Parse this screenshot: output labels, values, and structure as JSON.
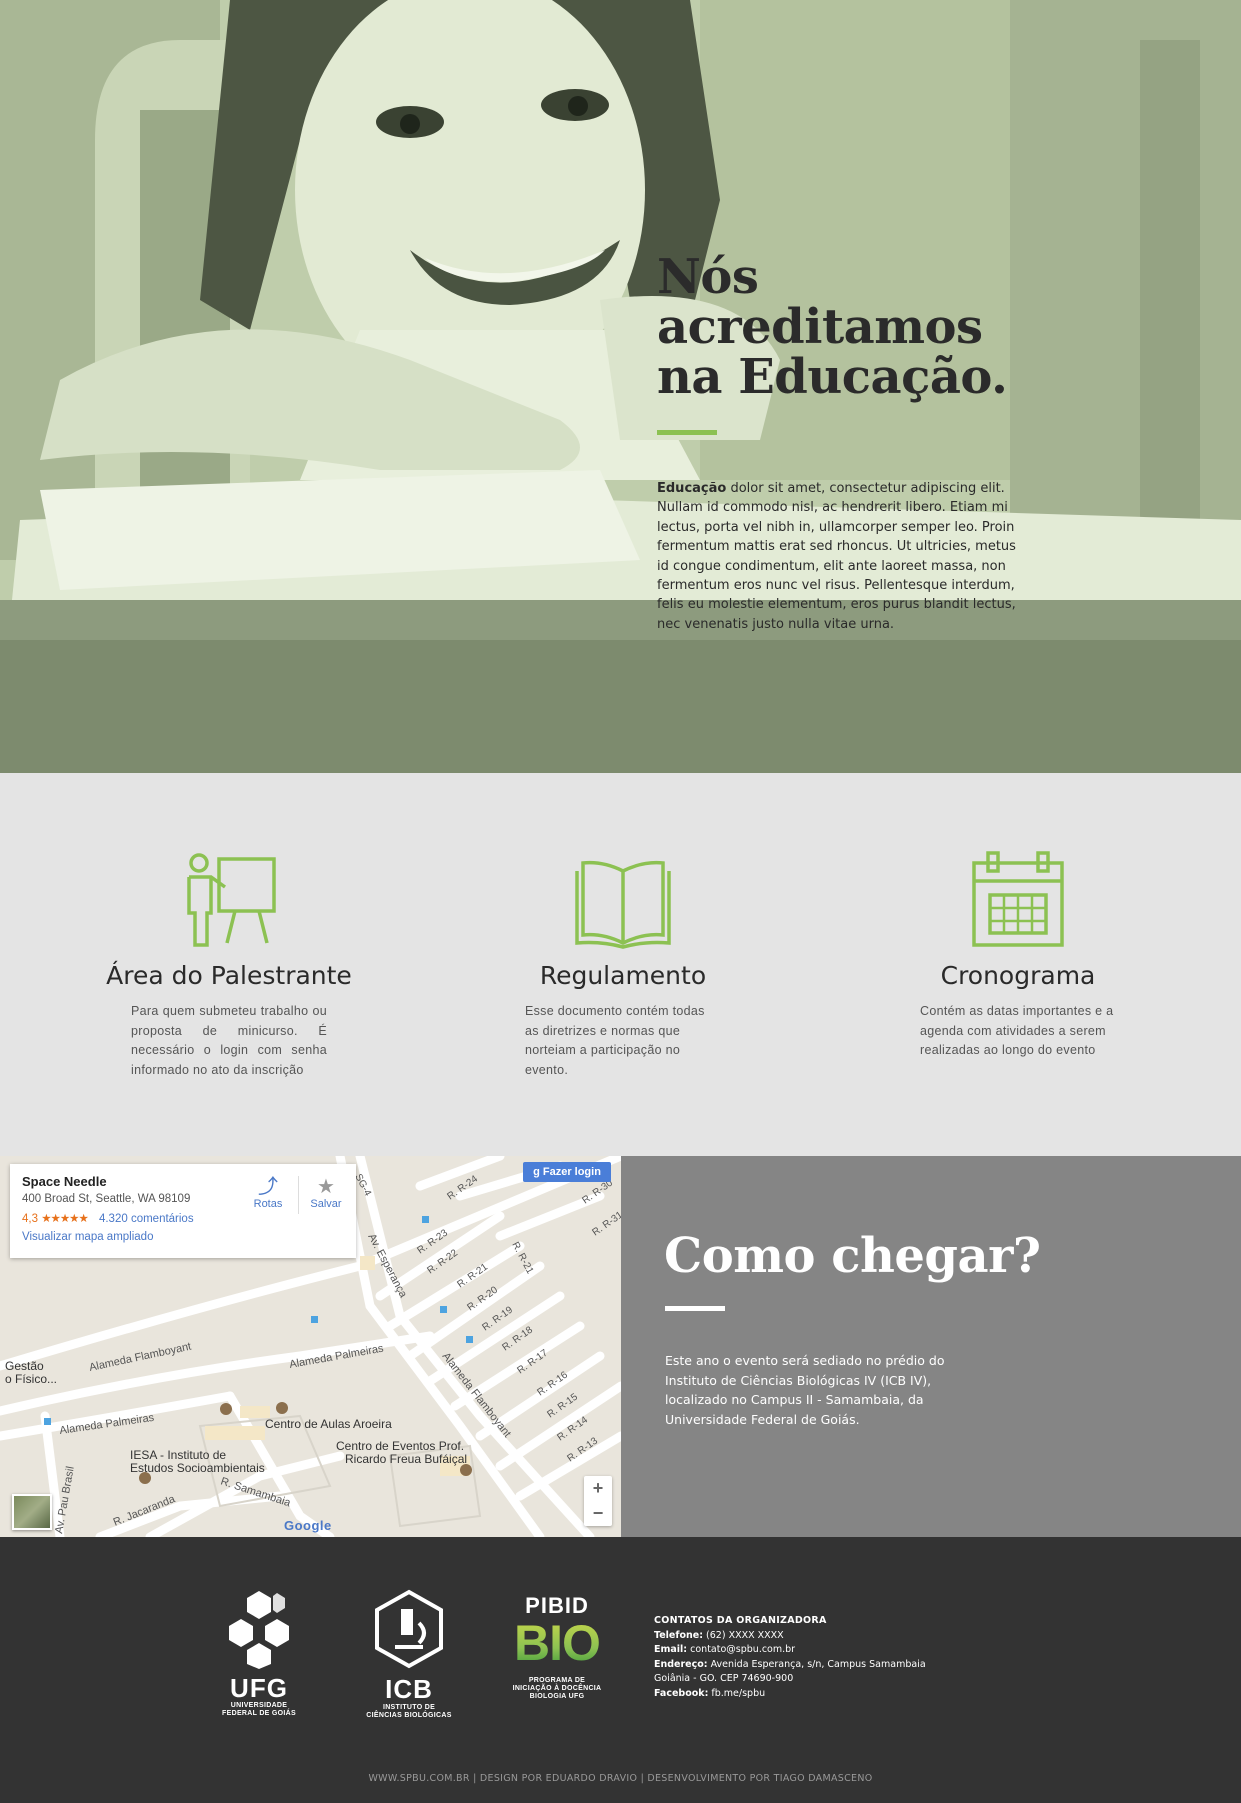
{
  "hero": {
    "title_line1": "Nós acreditamos",
    "title_line2": "na Educação.",
    "body_lead": "Educação",
    "body_text": " dolor sit amet, consectetur adipiscing elit. Nullam id commodo nisl, ac hendrerit libero. Etiam mi lectus, porta vel nibh in, ullamcorper semper leo. Proin fermentum mattis erat sed rhoncus. Ut ultricies, metus id congue condimentum, elit ante laoreet massa, non fermentum eros nunc vel risus. Pellentesque interdum, felis eu molestie elementum, eros purus blandit lectus, nec venenatis justo nulla vitae urna."
  },
  "features": [
    {
      "icon": "presenter-board-icon",
      "title": "Área do Palestrante",
      "text": "Para quem submeteu trabalho ou proposta de minicurso. É necessário o login com senha informado no ato da inscrição"
    },
    {
      "icon": "open-book-icon",
      "title": "Regulamento",
      "text": "Esse documento contém todas as diretrizes e normas que norteiam a participação no evento."
    },
    {
      "icon": "calendar-icon",
      "title": "Cronograma",
      "text": "Contém as datas importantes e a agenda com atividades a serem realizadas ao longo do evento"
    }
  ],
  "map": {
    "place_name": "Space Needle",
    "address": "400 Broad St, Seattle, WA 98109",
    "rating": "4,3",
    "stars": "★★★★★",
    "reviews": "4.320 comentários",
    "view_larger": "Visualizar mapa ampliado",
    "directions_label": "Rotas",
    "save_label": "Salvar",
    "login_label": "Fazer login",
    "zoom_in": "+",
    "zoom_out": "−",
    "google": "Google",
    "streets": [
      "Alameda Flamboyant",
      "Alameda Palmeiras",
      "Alameda Palmeiras",
      "Av. Esperança",
      "Alameda Flamboyant",
      "R. Samambaia",
      "R. Jacaranda",
      "Av. Pau Brasil",
      "R. R-24",
      "R. R-23",
      "R. R-22",
      "R. R-21",
      "R. R-20",
      "R. R-19",
      "R. R-18",
      "R. R-17",
      "R. R-16",
      "R. R-15",
      "R. R-14",
      "R. R-13",
      "R. R-30",
      "R. R-31",
      "R. R-21",
      "SG-4"
    ],
    "pois": [
      "Centro de Aulas Aroeira",
      "Centro de Eventos Prof.",
      "Ricardo Freua Bufáiçal",
      "IESA - Instituto de",
      "Estudos Socioambientais",
      "Gestão",
      "o Físico..."
    ]
  },
  "como_chegar": {
    "title": "Como chegar?",
    "text": "Este ano o evento será sediado no prédio do Instituto de Ciências Biológicas IV (ICB IV), localizado no Campus II - Samambaia, da Universidade Federal de Goiás."
  },
  "footer": {
    "logos": [
      {
        "name": "UFG",
        "sub1": "UNIVERSIDADE",
        "sub2": "FEDERAL DE GOIÁS"
      },
      {
        "name": "ICB",
        "sub1": "INSTITUTO DE",
        "sub2": "CIÊNCIAS BIOLÓGICAS"
      },
      {
        "name_top": "PIBID",
        "name": "BIO",
        "sub1": "PROGRAMA DE",
        "sub2": "INICIAÇÃO À DOCÊNCIA",
        "sub3": "BIOLOGIA UFG"
      }
    ],
    "contacts_head": "CONTATOS DA ORGANIZADORA",
    "phone_label": "Telefone:",
    "phone": " (62) XXXX XXXX",
    "email_label": "Email:",
    "email": " contato@spbu.com.br",
    "address_label": "Endereço:",
    "address": " Avenida Esperança, s/n, Campus Samambaia",
    "address2": "Goiânia - GO. CEP 74690-900",
    "facebook_label": "Facebook:",
    "facebook": " fb.me/spbu",
    "credits": "WWW.SPBU.COM.BR | DESIGN POR EDUARDO DRAVIO | DESENVOLVIMENTO POR TIAGO DAMASCENO"
  },
  "colors": {
    "accent_green": "#8cc152",
    "hero_tint": "#c8d4b5",
    "features_bg": "#e4e4e4",
    "chegar_bg": "#858585",
    "footer_bg": "#333333"
  }
}
